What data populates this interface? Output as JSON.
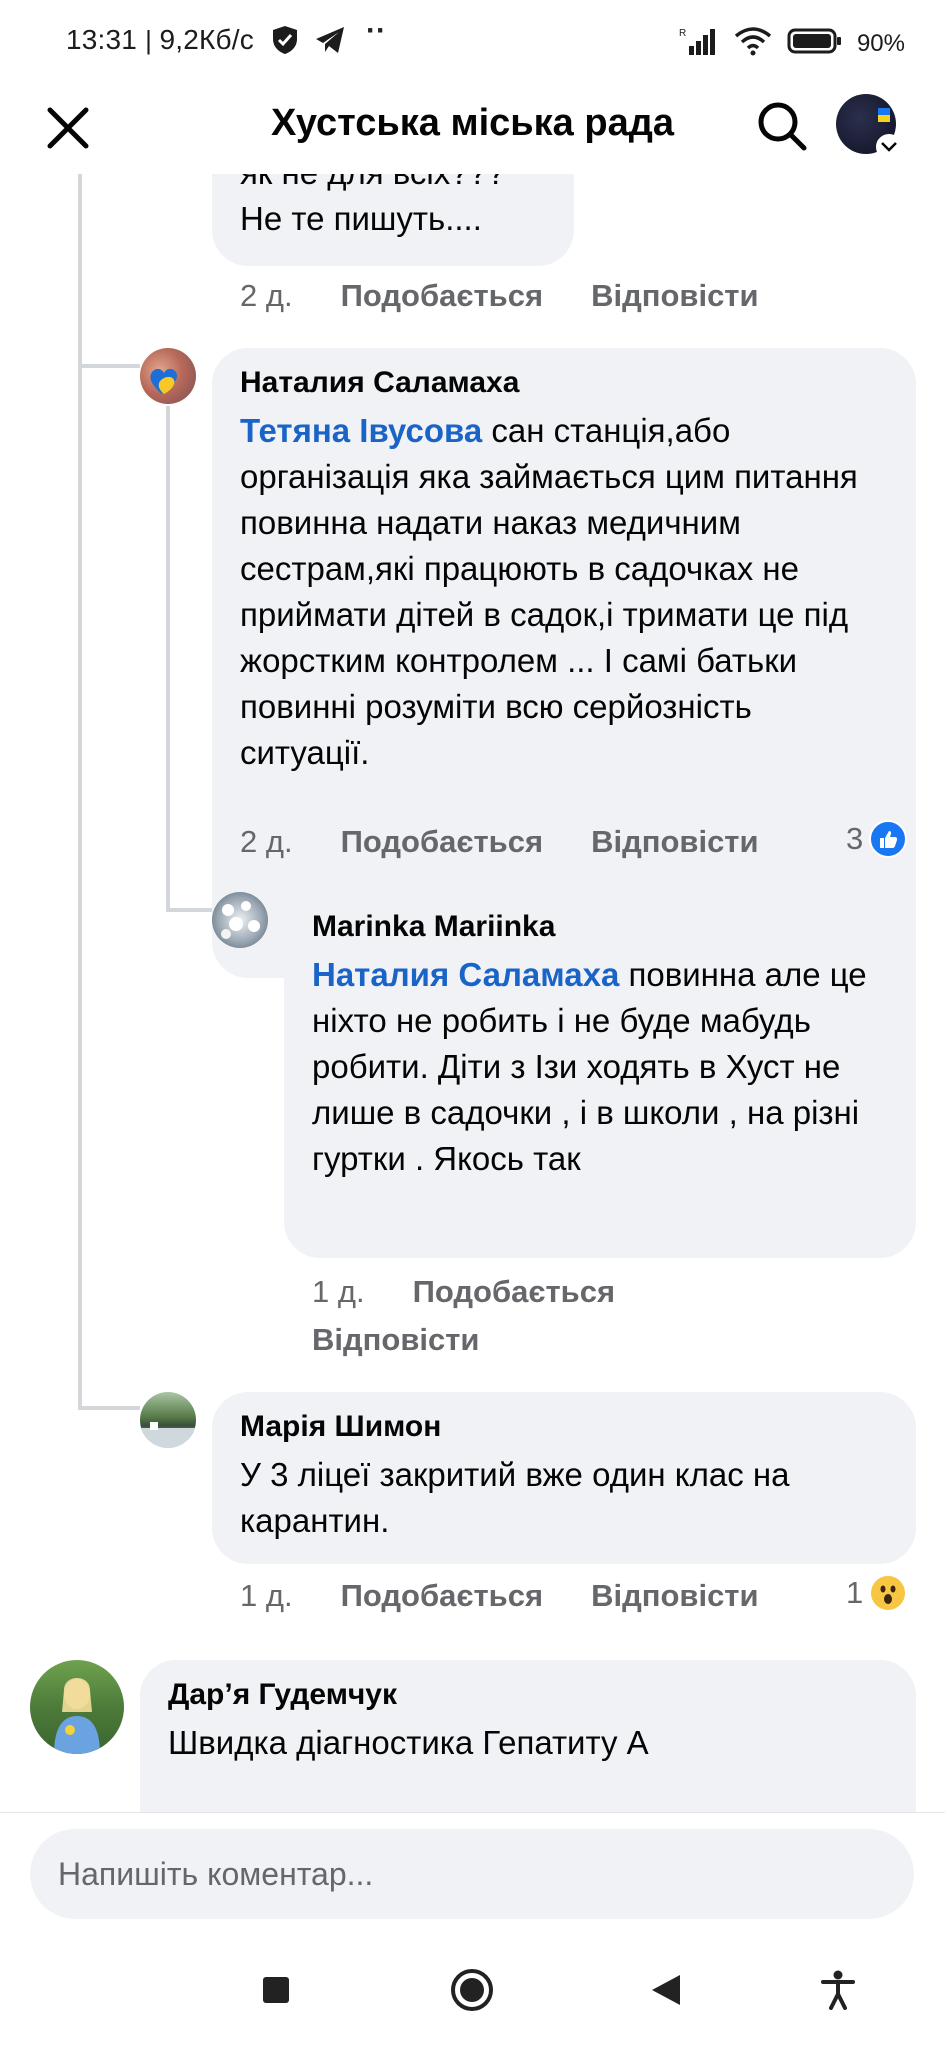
{
  "status_bar": {
    "time": "13:31",
    "network_speed": "9,2Кб/с",
    "battery": "90%",
    "icons": [
      "vpn-shield-icon",
      "telegram-icon",
      "more-dots-icon",
      "signal-icon",
      "wifi-icon",
      "battery-icon"
    ]
  },
  "nav": {
    "title": "Хустська міська рада",
    "icons": [
      "close-icon",
      "search-icon",
      "profile-avatar"
    ]
  },
  "comments": [
    {
      "id": "c0",
      "partial_text_top": "як не для всіх???",
      "text": "Не те пишуть....",
      "age": "2 д.",
      "like_label": "Подобається",
      "reply_label": "Відповісти"
    },
    {
      "id": "c1",
      "author": "Наталия Саламаха",
      "mention": "Тетяна Івусова",
      "text": " сан станція,або організація яка займається цим питання повинна надати наказ медичним сестрам,які працюють в садочках не приймати дітей в садок,і тримати це під жорстким контролем ... І самі батьки повинні розуміти всю серйозність ситуації.",
      "age": "2 д.",
      "like_label": "Подобається",
      "reply_label": "Відповісти",
      "reaction_count": "3",
      "reaction": "like"
    },
    {
      "id": "c2",
      "author": "Marinka Mariinka",
      "mention": "Наталия Саламаха",
      "text": " повинна але це ніхто не робить і не буде мабудь робити. Діти з Ізи ходять в Хуст не лише в садочки , і в школи , на різні гуртки . Якось так",
      "age": "1 д.",
      "like_label": "Подобається",
      "reply_label": "Відповісти"
    },
    {
      "id": "c3",
      "author": "Марія Шимон",
      "text": "У 3 ліцеї закритий вже один клас на карантин.",
      "age": "1 д.",
      "like_label": "Подобається",
      "reply_label": "Відповісти",
      "reaction_count": "1",
      "reaction": "wow"
    },
    {
      "id": "c4",
      "author": "Дар’я Гудемчук",
      "text": "Швидка діагностика Гепатиту А"
    }
  ],
  "composer": {
    "placeholder": "Напишіть коментар..."
  },
  "android_nav": {
    "icons": [
      "recent-apps-icon",
      "home-icon",
      "back-icon",
      "accessibility-icon"
    ]
  }
}
